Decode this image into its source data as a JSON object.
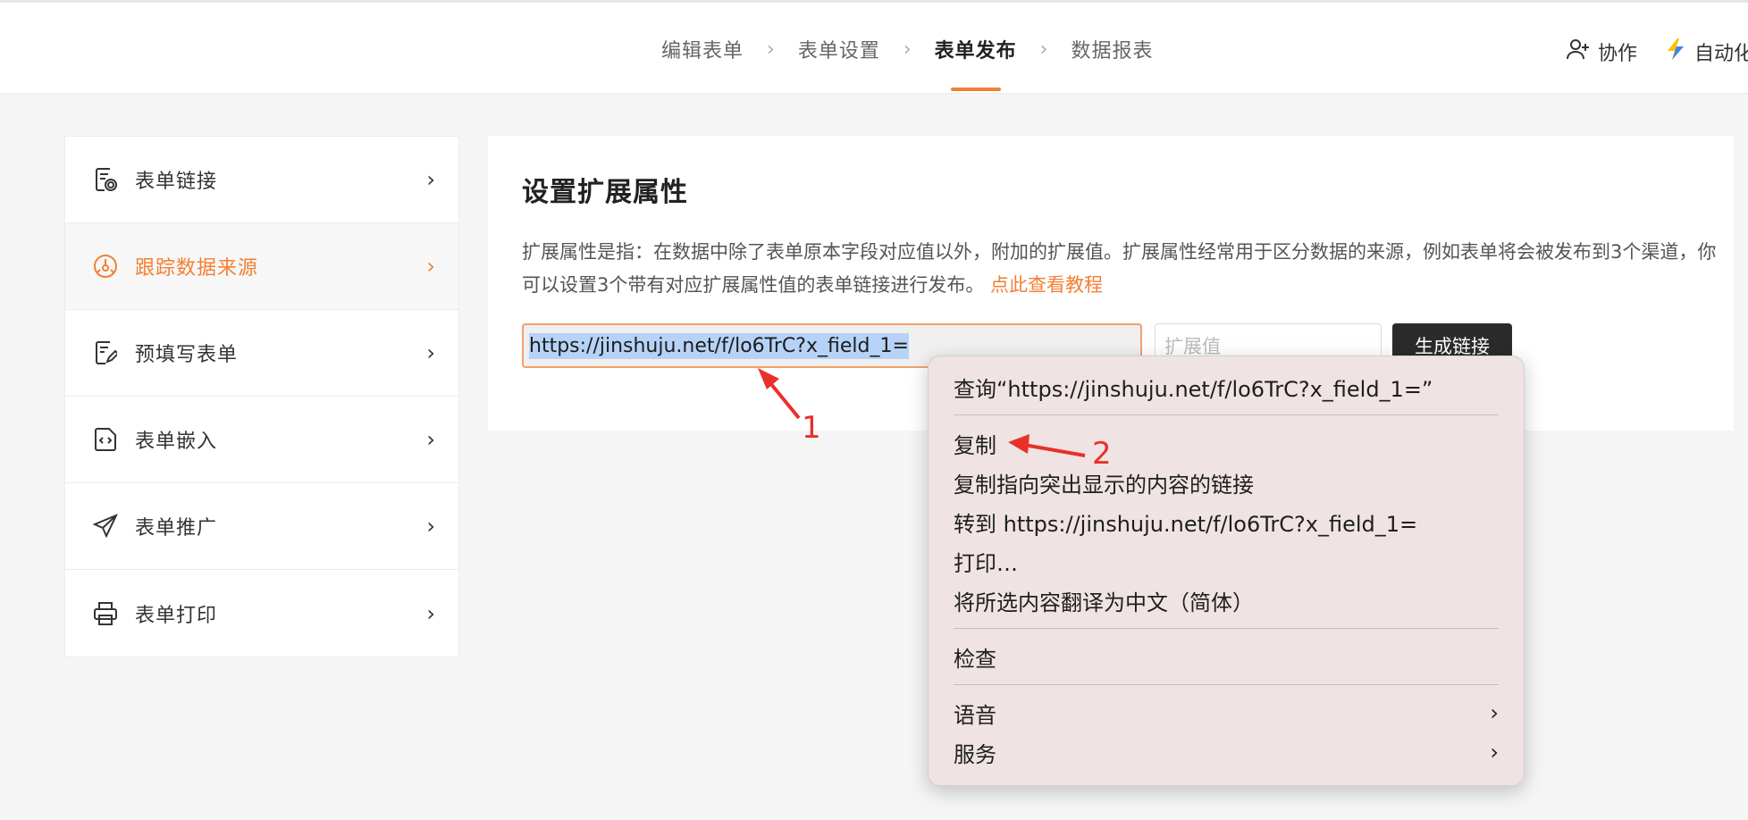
{
  "steps": [
    "编辑表单",
    "表单设置",
    "表单发布",
    "数据报表"
  ],
  "step_separator": "›",
  "active_step_index": 2,
  "topright": {
    "collab": "协作",
    "automation": "自动化"
  },
  "sidebar": {
    "items": [
      {
        "label": "表单链接",
        "icon": "form-link-icon"
      },
      {
        "label": "跟踪数据来源",
        "icon": "track-source-icon",
        "active": true
      },
      {
        "label": "预填写表单",
        "icon": "prefill-icon"
      },
      {
        "label": "表单嵌入",
        "icon": "embed-icon"
      },
      {
        "label": "表单推广",
        "icon": "send-icon"
      },
      {
        "label": "表单打印",
        "icon": "printer-icon"
      }
    ],
    "chevron": "›"
  },
  "main": {
    "title": "设置扩展属性",
    "desc_text": "扩展属性是指：在数据中除了表单原本字段对应值以外，附加的扩展值。扩展属性经常用于区分数据的来源，例如表单将会被发布到3个渠道，你可以设置3个带有对应扩展属性值的表单链接进行发布。",
    "desc_link": "点此查看教程",
    "url_value": "https://jinshuju.net/f/lo6TrC?x_field_1=",
    "ext_placeholder": "扩展值",
    "generate_label": "生成链接"
  },
  "context_menu": {
    "lookup": "查询“https://jinshuju.net/f/lo6TrC?x_field_1=”",
    "copy": "复制",
    "copy_link": "复制指向突出显示的内容的链接",
    "goto": "转到 https://jinshuju.net/f/lo6TrC?x_field_1=",
    "print": "打印…",
    "translate": "将所选内容翻译为中文（简体）",
    "inspect": "检查",
    "speech": "语音",
    "services": "服务",
    "chevron": "›"
  },
  "annotations": {
    "one": "1",
    "two": "2",
    "color": "#e8302a"
  },
  "colors": {
    "accent": "#f47f34",
    "dark_button": "#2b2b2b",
    "selection": "#b6d3f7"
  }
}
